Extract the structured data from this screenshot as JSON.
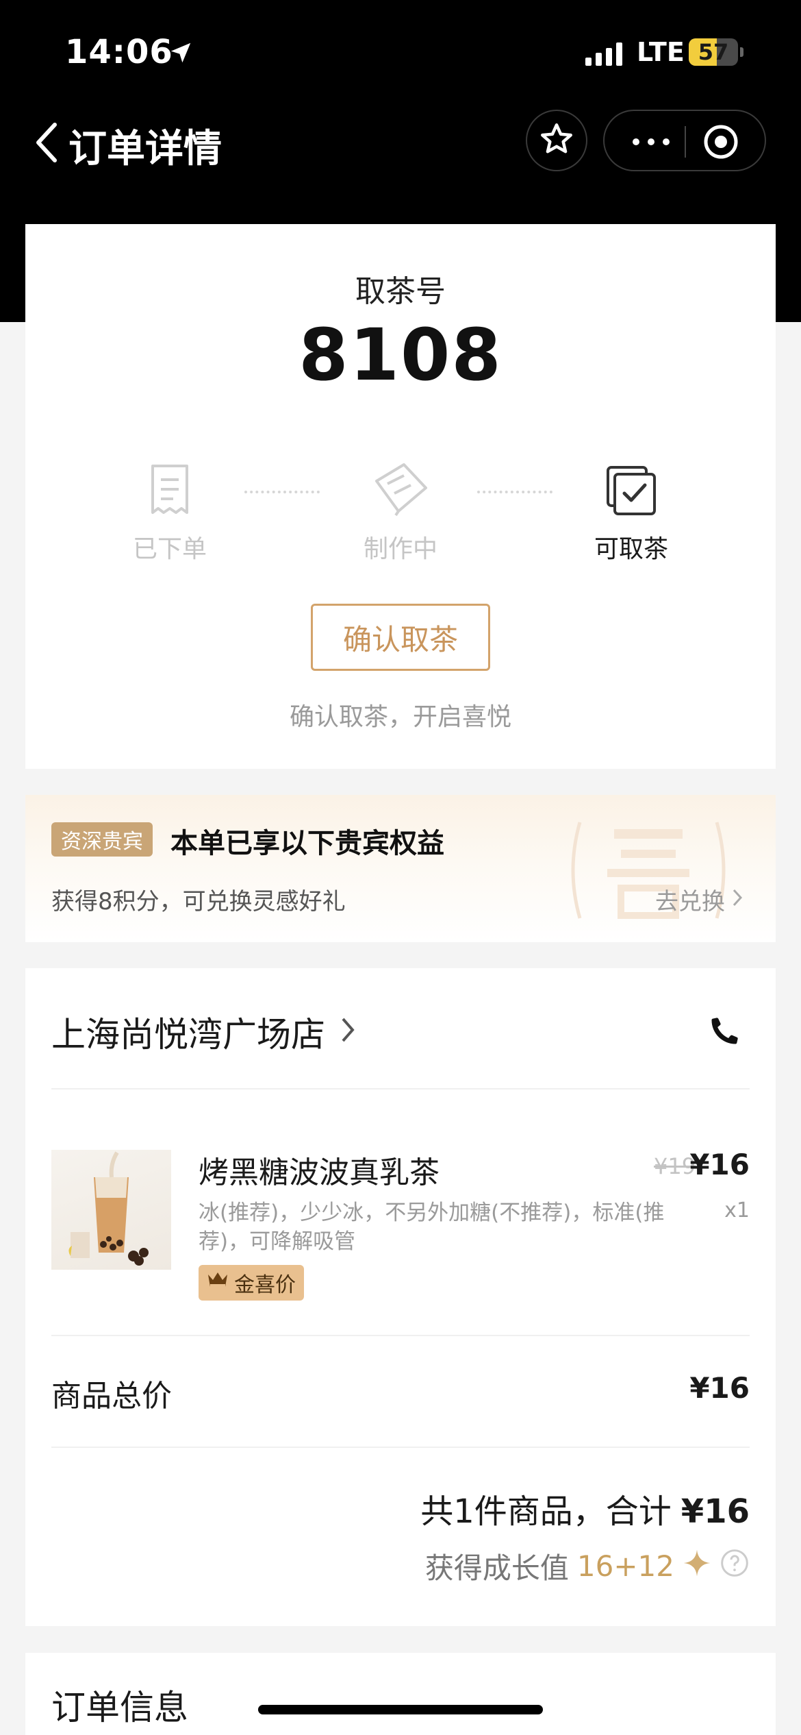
{
  "status_bar": {
    "time": "14:06",
    "network": "LTE",
    "battery": "57",
    "battery_level": 0.57
  },
  "nav": {
    "title": "订单详情"
  },
  "pickup": {
    "label": "取茶号",
    "number": "8108"
  },
  "steps": [
    {
      "label": "已下单",
      "icon": "receipt-icon",
      "active": false
    },
    {
      "label": "制作中",
      "icon": "drink-making-icon",
      "active": false
    },
    {
      "label": "可取茶",
      "icon": "check-box-icon",
      "active": true
    }
  ],
  "confirm": {
    "button_label": "确认取茶",
    "hint": "确认取茶，开启喜悦"
  },
  "vip": {
    "badge": "资深贵宾",
    "title": "本单已享以下贵宾权益",
    "subtitle": "获得8积分，可兑换灵感好礼",
    "link": "去兑换"
  },
  "store": {
    "name": "上海尚悦湾广场店"
  },
  "product": {
    "name": "烤黑糖波波真乳茶",
    "original_price": "¥19",
    "price": "¥16",
    "options": "冰(推荐)，少少冰，不另外加糖(不推荐)，标准(推荐)，可降解吸管",
    "quantity": "x1",
    "tag": "金喜价"
  },
  "summary": {
    "goods_total_label": "商品总价",
    "goods_total_value": "¥16",
    "total_text": "共1件商品，合计",
    "total_amount": "¥16",
    "growth_label": "获得成长值",
    "growth_value": "16+12"
  },
  "order_info": {
    "title": "订单信息"
  }
}
